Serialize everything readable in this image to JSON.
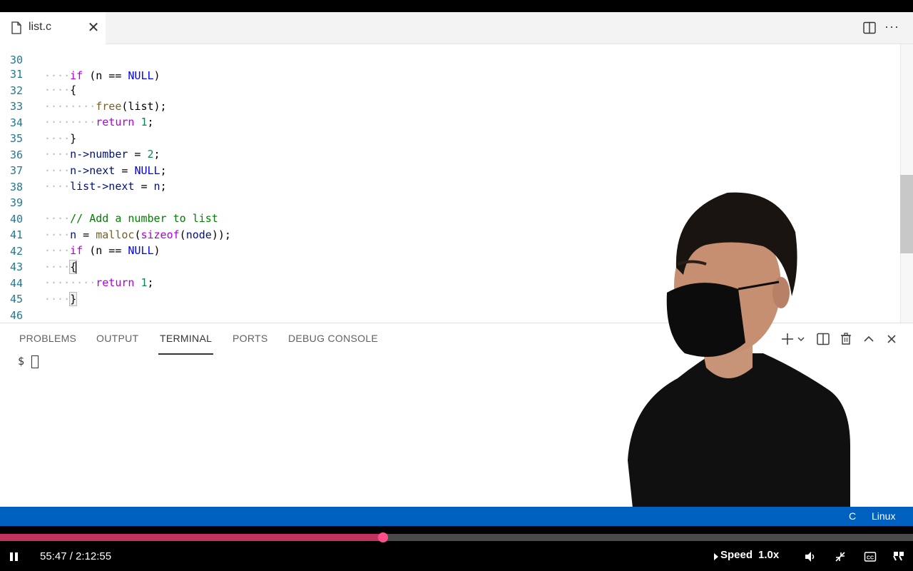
{
  "tab": {
    "filename": "list.c",
    "close_label": "✕"
  },
  "toolbar": {
    "more_label": "···"
  },
  "editor": {
    "partial_line": {
      "number": "30"
    },
    "lines": [
      {
        "number": "31"
      },
      {
        "number": "32"
      },
      {
        "number": "33"
      },
      {
        "number": "34"
      },
      {
        "number": "35"
      },
      {
        "number": "36"
      },
      {
        "number": "37"
      },
      {
        "number": "38"
      },
      {
        "number": "39"
      },
      {
        "number": "40"
      },
      {
        "number": "41"
      },
      {
        "number": "42"
      },
      {
        "number": "43"
      },
      {
        "number": "44"
      },
      {
        "number": "45"
      },
      {
        "number": "46"
      }
    ],
    "tokens": {
      "l30_if": "if",
      "l30_rest": " (n == ",
      "l30_null": "NULL",
      "l30_close": ")",
      "l31": "{",
      "l32_fn": "free",
      "l32_args": "(list);",
      "l33_kw": "return",
      "l33_num": "1",
      "l33_semi": ";",
      "l34": "}",
      "l35_var": "n->number",
      "l35_eq": " = ",
      "l35_num": "2",
      "l35_semi": ";",
      "l36_var": "n->next",
      "l36_eq": " = ",
      "l36_null": "NULL",
      "l36_semi": ";",
      "l37_var": "list->next",
      "l37_eq": " = ",
      "l37_n": "n",
      "l37_semi": ";",
      "l39_comment": "// Add a number to list",
      "l40_n": "n",
      "l40_eq": " = ",
      "l40_malloc": "malloc",
      "l40_open": "(",
      "l40_sizeof": "sizeof",
      "l40_open2": "(",
      "l40_node": "node",
      "l40_close": "));",
      "l41_if": "if",
      "l41_rest": " (n == ",
      "l41_null": "NULL",
      "l41_close": ")",
      "l42": "{",
      "l43_kw": "return",
      "l43_num": "1",
      "l43_semi": ";",
      "l44": "}",
      "l46": "}",
      "ws4": "····",
      "ws8": "········"
    }
  },
  "panel": {
    "tabs": [
      "PROBLEMS",
      "OUTPUT",
      "TERMINAL",
      "PORTS",
      "DEBUG CONSOLE"
    ],
    "active_tab": "TERMINAL",
    "prompt": "$"
  },
  "statusbar": {
    "language": "C",
    "platform": "Linux",
    "color": "#0060c0"
  },
  "player": {
    "time": "55:47 / 2:12:55",
    "speed_label": "Speed",
    "speed_value": "1.0x",
    "cc_label": "CC",
    "progress": 0.4195,
    "accent": "#c0335f"
  }
}
